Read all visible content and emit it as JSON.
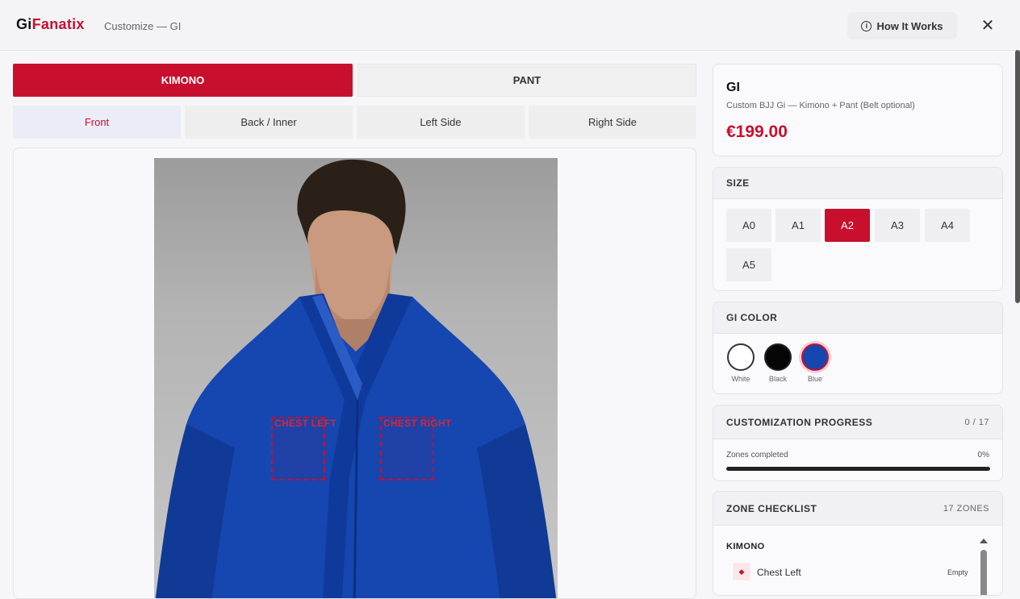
{
  "header": {
    "logo_gi": "Gi",
    "logo_fanatix": "Fanatix",
    "subtitle": "Customize — GI",
    "how_it_works": "How It Works",
    "close": "✕"
  },
  "main_tabs": [
    "KIMONO",
    "PANT"
  ],
  "view_tabs": [
    "Front",
    "Back / Inner",
    "Left Side",
    "Right Side"
  ],
  "zones": {
    "chest_left": "CHEST LEFT",
    "chest_right": "CHEST RIGHT"
  },
  "product": {
    "title": "GI",
    "description": "Custom BJJ Gi — Kimono + Pant (Belt optional)",
    "price": "€199.00"
  },
  "size": {
    "title": "SIZE",
    "options": [
      "A0",
      "A1",
      "A2",
      "A3",
      "A4",
      "A5"
    ],
    "selected": "A2"
  },
  "gi_color": {
    "title": "GI COLOR",
    "options": [
      {
        "label": "White",
        "color": "#ffffff"
      },
      {
        "label": "Black",
        "color": "#050505"
      },
      {
        "label": "Blue",
        "color": "#1646b0"
      }
    ],
    "selected": "Blue"
  },
  "progress": {
    "title": "CUSTOMIZATION PROGRESS",
    "count": "0 / 17",
    "label": "Zones completed",
    "percent": "0%",
    "value": 0
  },
  "checklist": {
    "title": "ZONE CHECKLIST",
    "count": "17 ZONES",
    "section": "KIMONO",
    "items": [
      {
        "label": "Chest Left",
        "status": "Empty"
      }
    ]
  },
  "colors": {
    "accent": "#c8102e",
    "gi_blue": "#1646b0"
  }
}
